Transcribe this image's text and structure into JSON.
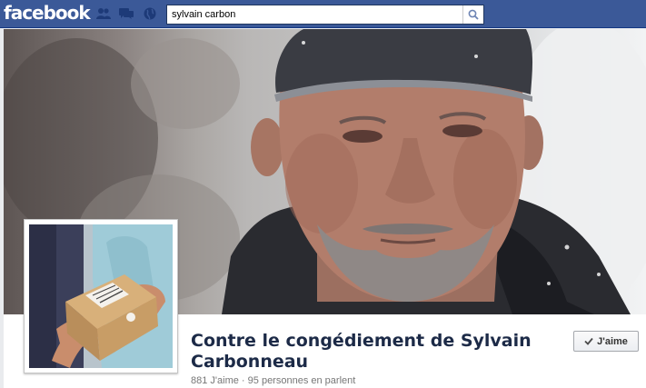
{
  "topbar": {
    "logo": "facebook",
    "jewels": [
      "friend-requests-icon",
      "messages-icon",
      "notifications-globe-icon"
    ],
    "search": {
      "value": "sylvain carbon",
      "icon": "search-icon"
    }
  },
  "page": {
    "title": "Contre le congédiement de Sylvain Carbonneau",
    "likes": "881 J'aime",
    "separator": "·",
    "talking": "95 personnes en parlent",
    "like_button": "J'aime"
  },
  "colors": {
    "topbar": "#3b5998",
    "title": "#1c2a47",
    "stats": "#777777"
  }
}
